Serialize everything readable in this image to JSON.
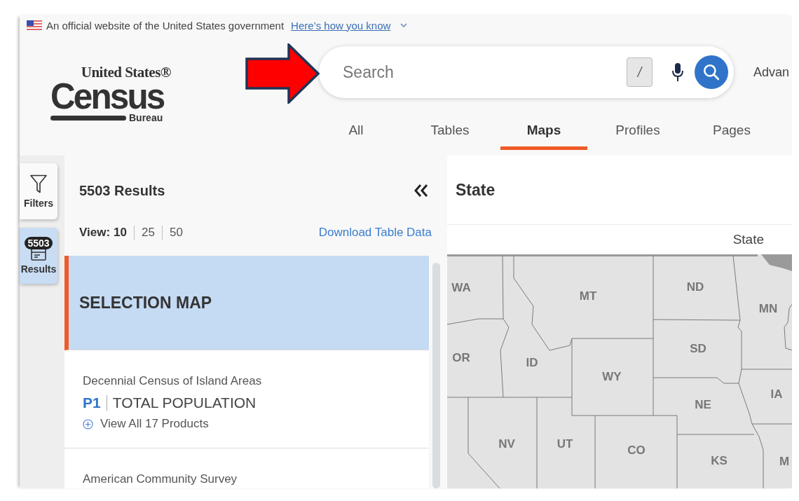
{
  "banner": {
    "text": "An official website of the United States government",
    "link": "Here’s how you know"
  },
  "logo": {
    "line1": "United States®",
    "main": "Census",
    "sub": "Bureau"
  },
  "search": {
    "placeholder": "Search",
    "shortcut": "/",
    "advanced": "Advan"
  },
  "tabs": [
    {
      "label": "All",
      "selected": false
    },
    {
      "label": "Tables",
      "selected": false
    },
    {
      "label": "Maps",
      "selected": true
    },
    {
      "label": "Profiles",
      "selected": false
    },
    {
      "label": "Pages",
      "selected": false
    }
  ],
  "rail": [
    {
      "kind": "filters",
      "label": "Filters",
      "selected": false
    },
    {
      "kind": "results",
      "label": "Results",
      "badge": "5503",
      "selected": true
    }
  ],
  "results": {
    "title": "5503 Results",
    "view_label": "View:",
    "view_options": [
      {
        "label": "10",
        "selected": true
      },
      {
        "label": "25",
        "selected": false
      },
      {
        "label": "50",
        "selected": false
      }
    ],
    "download": "Download Table Data",
    "items": [
      {
        "kind": "heading",
        "title": "SELECTION MAP",
        "selected": true
      },
      {
        "kind": "table",
        "survey": "Decennial Census of Island Areas",
        "code": "P1",
        "title": "TOTAL POPULATION",
        "more": "View All 17 Products",
        "selected": false
      },
      {
        "kind": "table",
        "survey": "American Community Survey",
        "selected": false
      }
    ]
  },
  "map_panel": {
    "title": "State",
    "legend": "State",
    "states": [
      {
        "abbr": "WA"
      },
      {
        "abbr": "MT"
      },
      {
        "abbr": "ND"
      },
      {
        "abbr": "MN"
      },
      {
        "abbr": "OR"
      },
      {
        "abbr": "ID"
      },
      {
        "abbr": "WY"
      },
      {
        "abbr": "SD"
      },
      {
        "abbr": "IA"
      },
      {
        "abbr": "NE"
      },
      {
        "abbr": "NV"
      },
      {
        "abbr": "UT"
      },
      {
        "abbr": "CO"
      },
      {
        "abbr": "KS"
      },
      {
        "abbr": "M"
      }
    ]
  }
}
